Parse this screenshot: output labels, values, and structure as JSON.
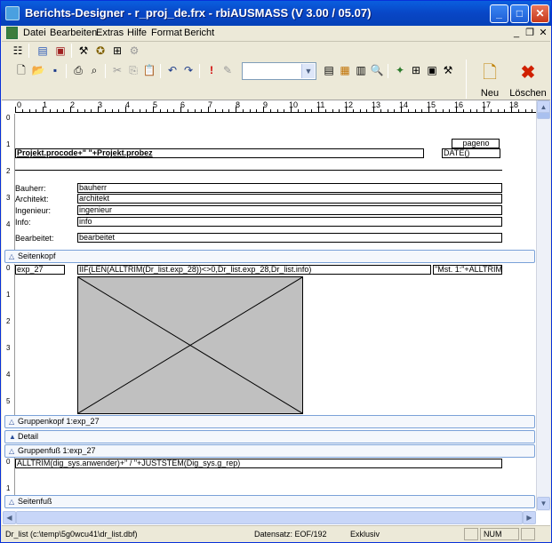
{
  "window": {
    "title": "Berichts-Designer - r_proj_de.frx - rbiAUSMASS (V 3.00 / 05.07)"
  },
  "title_buttons": {
    "minimize": "_",
    "maximize": "□",
    "close": "✕"
  },
  "menu": {
    "items": [
      "Datei",
      "Bearbeiten",
      "Extras",
      "Hilfe",
      "Format",
      "Bericht"
    ],
    "mdi": {
      "minimize": "_",
      "restore": "❐",
      "close": "✕"
    }
  },
  "toolbar": {
    "style_combo_value": "",
    "new_label": "Neu",
    "delete_label": "Löschen",
    "icons": {
      "top_row": [
        "report-properties-icon",
        "data-environment-icon",
        "page-layout-icon",
        "tools-icon",
        "wizard-icon",
        "preview-options-icon",
        "disabled-icon"
      ],
      "bottom_row": [
        "new-file-icon",
        "open-folder-icon",
        "save-icon",
        "print-icon",
        "print-preview-icon",
        "cut-icon",
        "copy-icon",
        "paste-icon",
        "undo-icon",
        "redo-icon",
        "exclamation-icon",
        "edit-icon",
        "style-combo",
        "list-icon",
        "field-icon",
        "form-icon",
        "preview-icon",
        "sparkle-icon",
        "grid-icon",
        "layout-icon",
        "tools2-icon"
      ]
    }
  },
  "ruler": {
    "horizontal": [
      "0",
      "1",
      "2",
      "3",
      "4",
      "5",
      "6",
      "7",
      "8",
      "9",
      "10",
      "11",
      "12",
      "13",
      "14",
      "15",
      "16",
      "17",
      "18"
    ],
    "page_header": [
      "0",
      "1",
      "2",
      "3",
      "4"
    ],
    "group_header": [
      "0",
      "1",
      "2",
      "3",
      "4",
      "5"
    ],
    "footer": [
      "0",
      "1"
    ]
  },
  "report": {
    "pageno": "pageno",
    "title_expr": "Projekt.procode+\" \"+Projekt.probez",
    "date_expr": "DATE()",
    "labels": {
      "bauherr": "Bauherr:",
      "architekt": "Architekt:",
      "ingenieur": "Ingenieur:",
      "info": "Info:",
      "bearbeitet": "Bearbeitet:"
    },
    "fields": {
      "bauherr": "bauherr",
      "architekt": "architekt",
      "ingenieur": "ingenieur",
      "info": "info",
      "bearbeitet": "bearbeitet"
    },
    "detail_code": "exp_27",
    "detail_expr": "IIF(LEN(ALLTRIM(Dr_list.exp_28))<>0,Dr_list.exp_28,Dr_list.info)",
    "detail_mst": "\"Mst. 1:\"+ALLTRIM(",
    "footer_expr": "ALLTRIM(dig_sys.anwender)+\" / \"+JUSTSTEM(Dig_sys.g_rep)"
  },
  "bands": {
    "seitenkopf": "Seitenkopf",
    "gruppenkopf": "Gruppenkopf 1:exp_27",
    "detail": "Detail",
    "gruppenfuss": "Gruppenfuß 1:exp_27",
    "seitenfuss": "Seitenfuß"
  },
  "status": {
    "table": "Dr_list (c:\\temp\\5g0wcu41\\dr_list.dbf)",
    "record": "Datensatz: EOF/192",
    "mode": "Exklusiv",
    "num": "NUM"
  },
  "colors": {
    "title_bar": "#0a5fdf",
    "band_border": "#7aa1d8",
    "picture_fill": "#c0c0c0"
  }
}
